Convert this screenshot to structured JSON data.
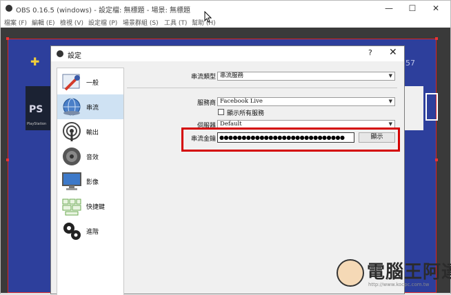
{
  "window": {
    "title": "OBS 0.16.5 (windows) - 設定檔: 無標題 - 場景: 無標題",
    "minimize_glyph": "—",
    "maximize_glyph": "☐",
    "close_glyph": "✕"
  },
  "menu": [
    "檔案 (F)",
    "編輯 (E)",
    "檢視 (V)",
    "設定檔 (P)",
    "場景群組 (S)",
    "工具 (T)",
    "幫助 (H)"
  ],
  "preview": {
    "corner_number": "57",
    "ps_label": "PlayStation"
  },
  "dialog": {
    "title": "設定",
    "help_glyph": "?",
    "close_glyph": "✕",
    "nav": [
      {
        "label": "一般",
        "icon": "wrench-icon",
        "selected": false
      },
      {
        "label": "串流",
        "icon": "globe-icon",
        "selected": true
      },
      {
        "label": "輸出",
        "icon": "broadcast-icon",
        "selected": false
      },
      {
        "label": "音效",
        "icon": "speaker-icon",
        "selected": false
      },
      {
        "label": "影像",
        "icon": "monitor-icon",
        "selected": false
      },
      {
        "label": "快捷鍵",
        "icon": "keyboard-icon",
        "selected": false
      },
      {
        "label": "進階",
        "icon": "gears-icon",
        "selected": false
      }
    ],
    "stream": {
      "type_label": "串流類型",
      "type_value": "串流服務",
      "service_label": "服務商",
      "service_value": "Facebook Live",
      "show_all_label": "顯示所有服務",
      "show_all_checked": false,
      "server_label": "伺服器",
      "server_value": "Default",
      "key_label": "串流金鑰",
      "key_value": "●●●●●●●●●●●●●●●●●●●●●●●●●●●●",
      "show_button": "顯示"
    }
  },
  "watermark": {
    "brand": "電腦王阿達",
    "url": "http://www.kocpc.com.tw"
  },
  "colors": {
    "preview_bg": "#2d3f9c",
    "highlight": "#d40000",
    "selected_nav": "#cfe2f3"
  }
}
